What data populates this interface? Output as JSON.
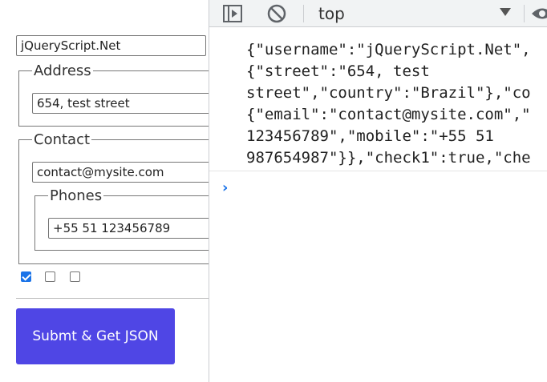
{
  "form": {
    "username_value": "jQueryScript.Net",
    "address": {
      "legend": "Address",
      "street_value": "654, test street"
    },
    "contact": {
      "legend": "Contact",
      "email_value": "contact@mysite.com",
      "phones": {
        "legend": "Phones",
        "phone_value": "+55 51 123456789"
      }
    },
    "checkboxes": [
      {
        "checked": true
      },
      {
        "checked": false
      },
      {
        "checked": false
      }
    ],
    "submit_label": "Submt & Get JSON"
  },
  "devtools": {
    "toolbar": {
      "icons": [
        "sidebar-toggle-icon",
        "clear-console-icon",
        "eye-icon"
      ],
      "context": "top"
    },
    "console": {
      "lines": [
        "{\"username\":\"jQueryScript.Net\",",
        "{\"street\":\"654, test",
        "street\",\"country\":\"Brazil\"},\"co",
        "{\"email\":\"contact@mysite.com\",\"",
        "123456789\",\"mobile\":\"+55 51",
        "987654987\"}},\"check1\":true,\"che"
      ],
      "prompt": "›"
    },
    "colors": {
      "accent": "#1a73e8",
      "submit_bg": "#4f46e5"
    }
  }
}
